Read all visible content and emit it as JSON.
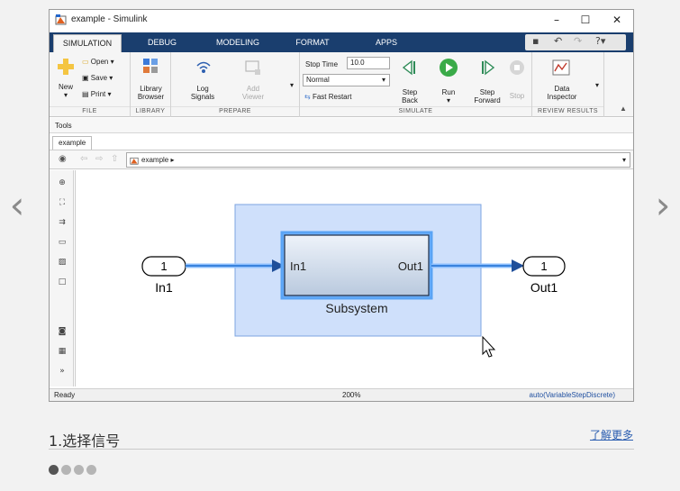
{
  "window": {
    "title": "example - Simulink"
  },
  "tabs": [
    {
      "label": "SIMULATION",
      "active": true
    },
    {
      "label": "DEBUG",
      "active": false
    },
    {
      "label": "MODELING",
      "active": false
    },
    {
      "label": "FORMAT",
      "active": false
    },
    {
      "label": "APPS",
      "active": false
    }
  ],
  "ribbon": {
    "file": {
      "label": "FILE",
      "new": "New",
      "open": "Open",
      "save": "Save",
      "print": "Print"
    },
    "library": {
      "label": "LIBRARY",
      "library_browser": "Library\nBrowser"
    },
    "prepare": {
      "label": "PREPARE",
      "log_signals": "Log\nSignals",
      "add_viewer": "Add\nViewer"
    },
    "simulate": {
      "label": "SIMULATE",
      "stop_time_label": "Stop Time",
      "stop_time_value": "10.0",
      "mode_value": "Normal",
      "fast_restart": "Fast Restart",
      "step_back": "Step\nBack",
      "run": "Run",
      "step_forward": "Step\nForward",
      "stop": "Stop"
    },
    "review": {
      "label": "REVIEW RESULTS",
      "data_inspector": "Data\nInspector"
    }
  },
  "tools_label": "Tools",
  "model_tab": "example",
  "address": "example",
  "diagram": {
    "inport": {
      "number": "1",
      "name": "In1"
    },
    "subsystem": {
      "name": "Subsystem",
      "in_port": "In1",
      "out_port": "Out1"
    },
    "outport": {
      "number": "1",
      "name": "Out1"
    }
  },
  "status": {
    "left": "Ready",
    "zoom": "200%",
    "solver": "auto(VariableStepDiscrete)"
  },
  "section": {
    "title": "1.选择信号",
    "learn_more": "了解更多"
  },
  "pager": {
    "count": 4,
    "active_index": 0
  },
  "colors": {
    "tab_bar": "#1a3e6e",
    "selection": "#cfe0fb",
    "signal": "#1f6fd0",
    "link": "#2a5db0"
  }
}
